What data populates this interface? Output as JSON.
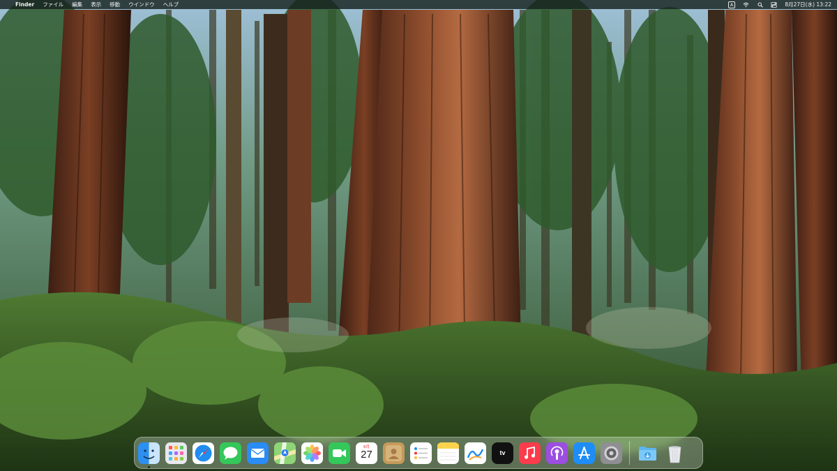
{
  "menubar": {
    "app_name": "Finder",
    "menus": [
      "ファイル",
      "編集",
      "表示",
      "移動",
      "ウインドウ",
      "ヘルプ"
    ],
    "input_mode": "A",
    "clock": "8月27日(水) 13:22"
  },
  "dock": {
    "items": [
      {
        "name": "Finder",
        "icon": "finder-icon",
        "running": true
      },
      {
        "name": "Launchpad",
        "icon": "launchpad-icon",
        "running": false
      },
      {
        "name": "Safari",
        "icon": "safari-icon",
        "running": false
      },
      {
        "name": "Messages",
        "icon": "messages-icon",
        "running": false
      },
      {
        "name": "Mail",
        "icon": "mail-icon",
        "running": false
      },
      {
        "name": "Maps",
        "icon": "maps-icon",
        "running": false
      },
      {
        "name": "Photos",
        "icon": "photos-icon",
        "running": false
      },
      {
        "name": "FaceTime",
        "icon": "facetime-icon",
        "running": false
      },
      {
        "name": "Calendar",
        "icon": "calendar-icon",
        "running": false
      },
      {
        "name": "Contacts",
        "icon": "contacts-icon",
        "running": false
      },
      {
        "name": "Reminders",
        "icon": "reminders-icon",
        "running": false
      },
      {
        "name": "Notes",
        "icon": "notes-icon",
        "running": false
      },
      {
        "name": "Freeform",
        "icon": "freeform-icon",
        "running": false
      },
      {
        "name": "TV",
        "icon": "tv-icon",
        "running": false
      },
      {
        "name": "Music",
        "icon": "music-icon",
        "running": false
      },
      {
        "name": "Podcasts",
        "icon": "podcasts-icon",
        "running": false
      },
      {
        "name": "App Store",
        "icon": "app-store-icon",
        "running": false
      },
      {
        "name": "System Settings",
        "icon": "system-settings-icon",
        "running": false
      },
      {
        "name": "Downloads",
        "icon": "downloads-folder-icon",
        "running": false
      },
      {
        "name": "Trash",
        "icon": "trash-icon",
        "running": false
      }
    ],
    "calendar_month": "8月",
    "calendar_day": "27",
    "tv_label": "tv"
  }
}
